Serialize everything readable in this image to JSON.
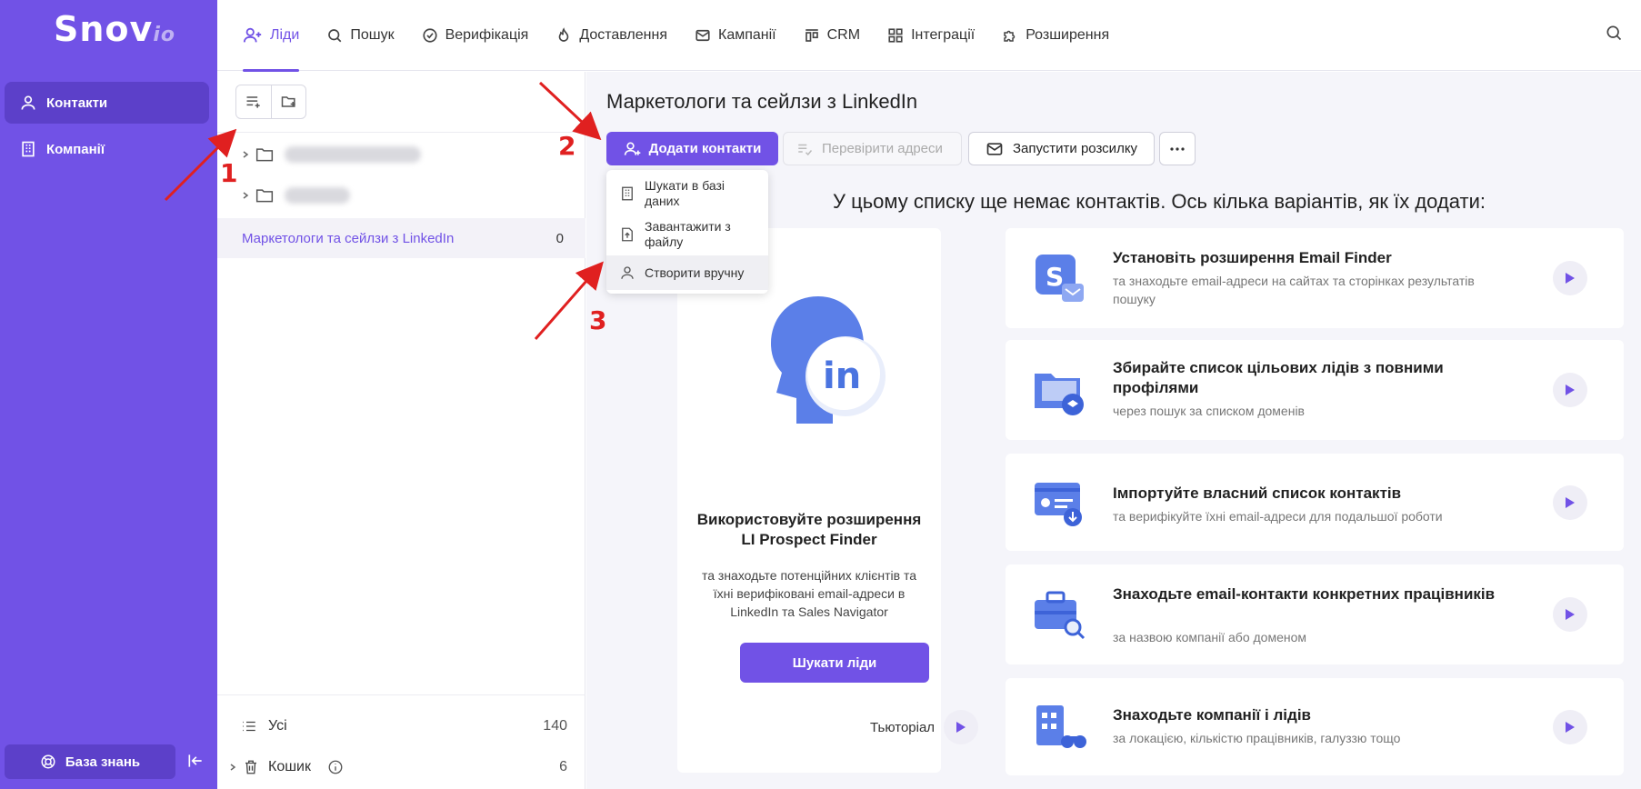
{
  "logo": {
    "text": "Snov",
    "suffix": "io"
  },
  "sidebar": {
    "items": [
      {
        "label": "Контакти"
      },
      {
        "label": "Компанії"
      }
    ],
    "knowledge_base": "База знань"
  },
  "nav": {
    "tabs": [
      {
        "label": "Ліди",
        "icon": "leads-icon"
      },
      {
        "label": "Пошук",
        "icon": "search-icon"
      },
      {
        "label": "Верифікація",
        "icon": "check-circle-icon"
      },
      {
        "label": "Доставлення",
        "icon": "flame-icon"
      },
      {
        "label": "Кампанії",
        "icon": "mail-icon"
      },
      {
        "label": "CRM",
        "icon": "crm-icon"
      },
      {
        "label": "Інтеграції",
        "icon": "grid-icon"
      },
      {
        "label": "Розширення",
        "icon": "puzzle-icon"
      }
    ]
  },
  "lists": {
    "active": {
      "name": "Маркетологи та сейлзи з LinkedIn",
      "count": "0"
    },
    "all": {
      "label": "Усі",
      "count": "140"
    },
    "trash": {
      "label": "Кошик",
      "count": "6"
    }
  },
  "main": {
    "title": "Маркетологи та сейлзи з LinkedIn",
    "add_button": "Додати контакти",
    "verify_button": "Перевірити адреси",
    "send_button": "Запустити розсилку",
    "dropdown": [
      {
        "label": "Шукати в базі даних"
      },
      {
        "label": "Завантажити з файлу"
      },
      {
        "label": "Створити вручну"
      }
    ],
    "empty_message": "У цьому списку ще немає контактів. Ось кілька варіантів, як їх додати:",
    "li_card": {
      "title_line1": "Використовуйте розширення",
      "title_line2": "LI Prospect Finder",
      "desc": "та знаходьте потенційних клієнтів та їхні верифіковані email-адреси в LinkedIn та Sales Navigator",
      "button": "Шукати ліди",
      "tutorial": "Тьюторіал"
    },
    "cards": [
      {
        "title": "Установіть розширення Email Finder",
        "sub": "та знаходьте email-адреси на сайтах та сторінках результатів пошуку"
      },
      {
        "title": "Збирайте список цільових лідів з повними профілями",
        "sub": "через пошук за списком доменів"
      },
      {
        "title": "Імпортуйте власний список контактів",
        "sub": "та верифікуйте їхні email-адреси для подальшої роботи"
      },
      {
        "title": "Знаходьте email-контакти конкретних працівників",
        "sub": "за назвою компанії або доменом"
      },
      {
        "title": "Знаходьте компанії і лідів",
        "sub": "за локацією, кількістю працівників, галуззю тощо"
      }
    ]
  },
  "annotations": [
    "1",
    "2",
    "3"
  ],
  "colors": {
    "brand": "#7152e6",
    "brand_dark": "#5c40c9",
    "annotation": "#e02020"
  }
}
